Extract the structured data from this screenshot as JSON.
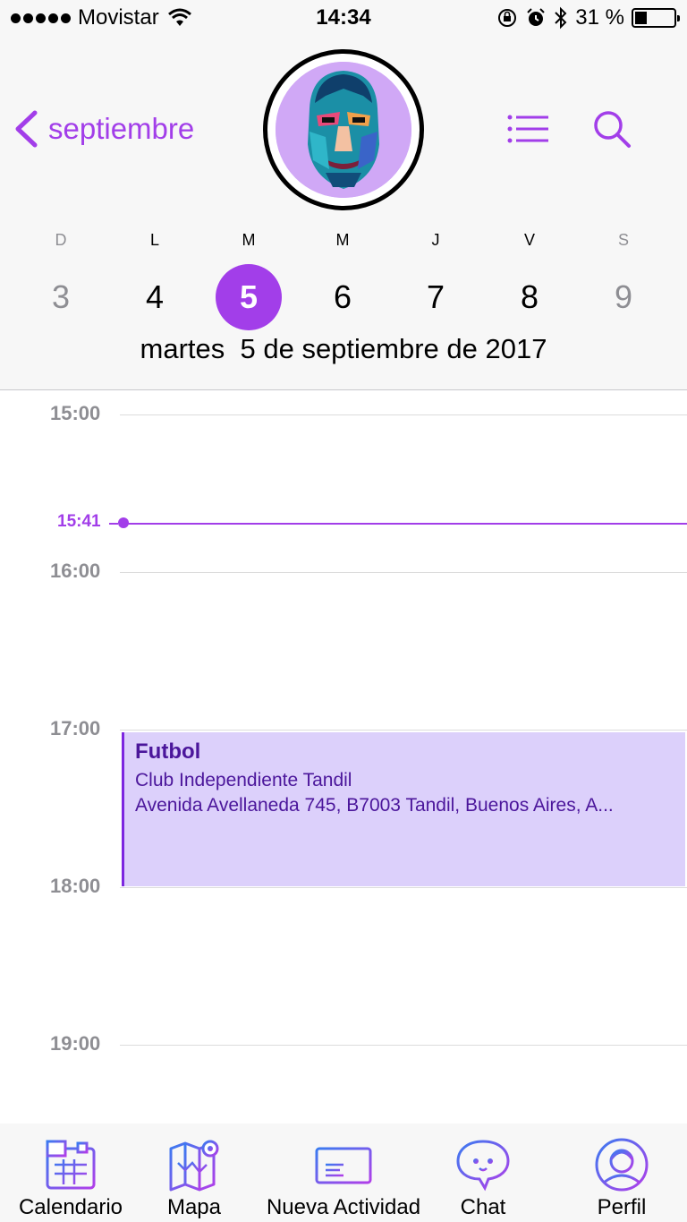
{
  "status_bar": {
    "carrier": "Movistar",
    "time": "14:34",
    "battery_percent": "31 %",
    "battery_level": 0.31,
    "icons": [
      "signal-dots-icon",
      "wifi-icon",
      "rotation-lock-icon",
      "alarm-icon",
      "bluetooth-icon",
      "battery-icon"
    ]
  },
  "header": {
    "back_label": "septiembre",
    "weekdays": [
      "D",
      "L",
      "M",
      "M",
      "J",
      "V",
      "S"
    ],
    "days": [
      "3",
      "4",
      "5",
      "6",
      "7",
      "8",
      "9"
    ],
    "selected_day_index": 2,
    "date_label": "martes  5 de septiembre de 2017",
    "icons": [
      "back-chevron-icon",
      "list-icon",
      "search-icon",
      "avatar"
    ]
  },
  "timeline": {
    "hours": [
      "15:00",
      "16:00",
      "17:00",
      "18:00",
      "19:00"
    ],
    "current_time": "15:41",
    "event": {
      "title": "Futbol",
      "location": "Club Independiente Tandil",
      "address": "Avenida Avellaneda 745, B7003 Tandil, Buenos Aires, A..."
    }
  },
  "tabbar": {
    "items": [
      {
        "label": "Calendario",
        "icon": "calendar-icon"
      },
      {
        "label": "Mapa",
        "icon": "map-icon"
      },
      {
        "label": "Nueva Actividad",
        "icon": "ticket-icon"
      },
      {
        "label": "Chat",
        "icon": "chat-icon"
      },
      {
        "label": "Perfil",
        "icon": "profile-icon"
      }
    ]
  },
  "colors": {
    "accent": "#a23ee9",
    "event_bg": "#dcd0fb",
    "event_text": "#4b169b",
    "gray_text": "#8e8e93"
  }
}
